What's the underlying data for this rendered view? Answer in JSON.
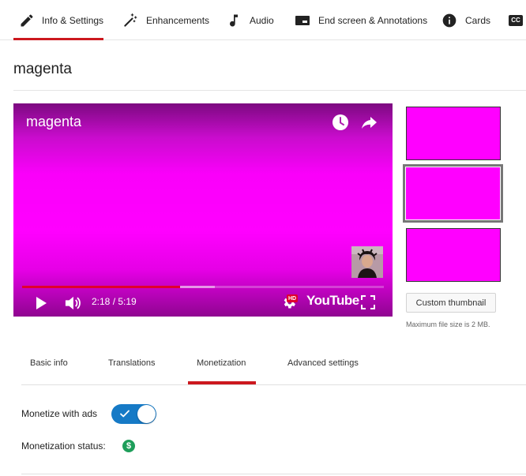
{
  "tabs": [
    {
      "label": "Info & Settings",
      "icon": "pencil-icon"
    },
    {
      "label": "Enhancements",
      "icon": "magic-wand-icon"
    },
    {
      "label": "Audio",
      "icon": "music-note-icon"
    },
    {
      "label": "End screen & Annotations",
      "icon": "end-screen-icon"
    },
    {
      "label": "Cards",
      "icon": "info-circle-icon"
    },
    {
      "label": "CC",
      "icon": "closed-captions-icon"
    }
  ],
  "active_tab": "Info & Settings",
  "video": {
    "title": "magenta",
    "time": "2:18 / 5:19",
    "played_fraction": 0.437,
    "buffered_fraction": 0.533,
    "logo_text": "YouTube",
    "hd_badge": "HD"
  },
  "thumbnails": {
    "color": "#ff00ff",
    "count": 3,
    "selected_index": 1,
    "custom_button": "Custom thumbnail",
    "note": "Maximum file size is 2 MB."
  },
  "subtabs": [
    "Basic info",
    "Translations",
    "Monetization",
    "Advanced settings"
  ],
  "active_subtab": "Monetization",
  "monetization": {
    "ads_label": "Monetize with ads",
    "ads_enabled": true,
    "status_label": "Monetization status:",
    "status_icon": "$"
  },
  "colors": {
    "accent_red": "#cc181e",
    "toggle_blue": "#167ac6",
    "status_green": "#1e9e5a",
    "progress_red": "#e1002d"
  }
}
